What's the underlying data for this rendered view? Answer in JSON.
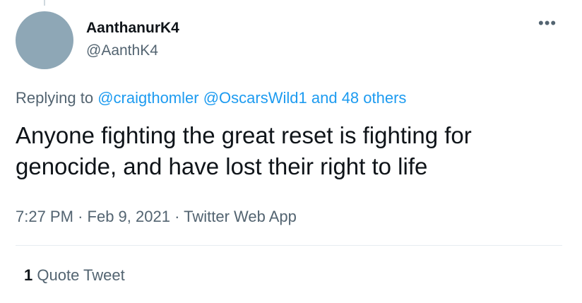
{
  "author": {
    "display_name": "AanthanurK4",
    "handle": "@AanthK4"
  },
  "reply": {
    "prefix": "Replying to",
    "mention1": "@craigthomler",
    "mention2": "@OscarsWild1",
    "more": "and 48 others"
  },
  "tweet": {
    "text": "Anyone fighting the great reset is fighting for genocide, and have lost their right to life",
    "time": "7:27 PM",
    "sep1": "·",
    "date": "Feb 9, 2021",
    "sep2": "·",
    "source": "Twitter Web App"
  },
  "stats": {
    "quote_count": "1",
    "quote_label": "Quote Tweet"
  },
  "icons": {
    "more": "more-options-icon"
  },
  "colors": {
    "link": "#1d9bf0",
    "avatar": "#8ea7b6",
    "secondary_text": "#536471"
  }
}
